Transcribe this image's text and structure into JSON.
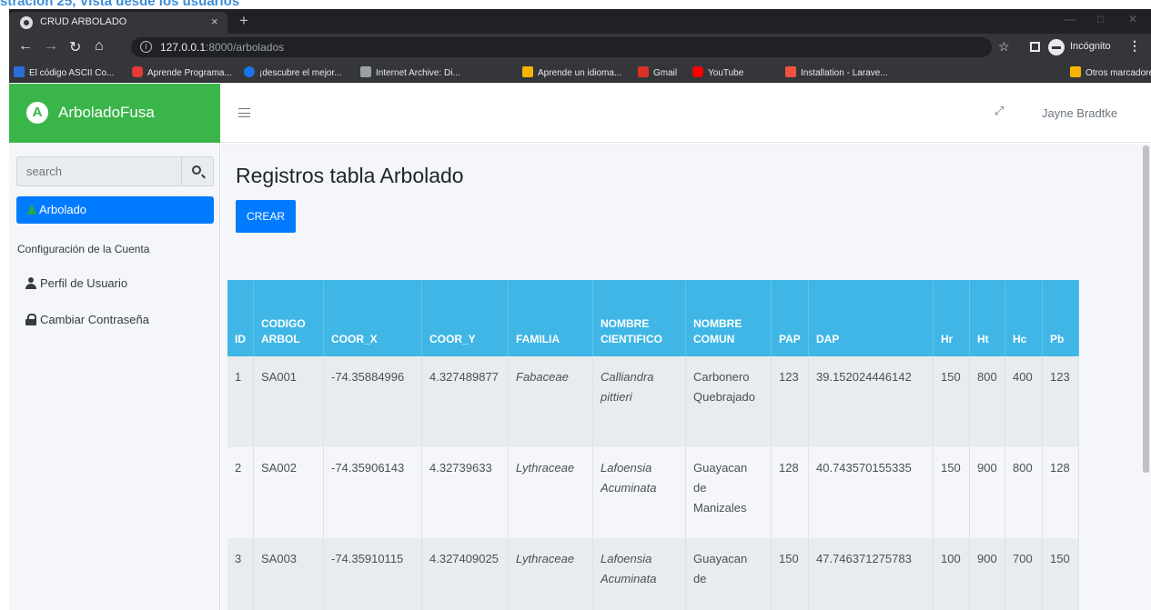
{
  "caption": "stración 25, Vista desde los usuarios",
  "browser": {
    "tab_title": "CRUD ARBOLADO",
    "tab_close": "×",
    "new_tab": "+",
    "url_host": "127.0.0.1",
    "url_rest": ":8000/arbolados",
    "incognito_label": "Incógnito",
    "bookmarks": [
      {
        "label": "El código ASCII Co...",
        "color": "#2a6fdb"
      },
      {
        "label": "Aprende Programa...",
        "color": "#e53935"
      },
      {
        "label": "¡descubre el mejor...",
        "color": "#1a73e8"
      },
      {
        "label": "Internet Archive: Di...",
        "color": "#9aa0a6"
      },
      {
        "label": "Aprende un idioma...",
        "color": "#f6b400"
      },
      {
        "label": "Gmail",
        "color": "#d93025"
      },
      {
        "label": "YouTube",
        "color": "#ff0000"
      },
      {
        "label": "Installation - Larave...",
        "color": "#f05340"
      },
      {
        "label": "Otros marcadores",
        "color": "#f6b400"
      }
    ]
  },
  "sidebar": {
    "brand": "ArboladoFusa",
    "brand_logo": "A",
    "search_placeholder": "search",
    "active_item": "Arbolado",
    "section_header": "Configuración de la Cuenta",
    "items": [
      {
        "label": "Perfil de Usuario",
        "icon": "user-icon"
      },
      {
        "label": "Cambiar Contraseña",
        "icon": "lock-icon"
      }
    ]
  },
  "header": {
    "user_name": "Jayne Bradtke"
  },
  "main": {
    "title": "Registros tabla Arbolado",
    "create_button": "CREAR",
    "table": {
      "columns": [
        [
          "ID"
        ],
        [
          "CODIGO",
          "ARBOL"
        ],
        [
          "COOR_X"
        ],
        [
          "COOR_Y"
        ],
        [
          "FAMILIA"
        ],
        [
          "NOMBRE",
          "CIENTIFICO"
        ],
        [
          "NOMBRE",
          "COMUN"
        ],
        [
          "PAP"
        ],
        [
          "DAP"
        ],
        [
          "Hr"
        ],
        [
          "Ht"
        ],
        [
          "Hc"
        ],
        [
          "Pb"
        ]
      ],
      "rows": [
        [
          [
            "1"
          ],
          [
            "SA001"
          ],
          [
            "-74.35884996"
          ],
          [
            "4.327489877"
          ],
          [
            "Fabaceae"
          ],
          [
            "Calliandra",
            "pittieri"
          ],
          [
            "Carbonero",
            "Quebrajado"
          ],
          [
            "123"
          ],
          [
            "39.152024446142"
          ],
          [
            "150"
          ],
          [
            "800"
          ],
          [
            "400"
          ],
          [
            "123"
          ]
        ],
        [
          [
            "2"
          ],
          [
            "SA002"
          ],
          [
            "-74.35906143"
          ],
          [
            "4.32739633"
          ],
          [
            "Lythraceae"
          ],
          [
            "Lafoensia",
            "Acuminata"
          ],
          [
            "Guayacan",
            "de",
            "Manizales"
          ],
          [
            "128"
          ],
          [
            "40.743570155335"
          ],
          [
            "150"
          ],
          [
            "900"
          ],
          [
            "800"
          ],
          [
            "128"
          ]
        ],
        [
          [
            "3"
          ],
          [
            "SA003"
          ],
          [
            "-74.35910115"
          ],
          [
            "4.327409025"
          ],
          [
            "Lythraceae"
          ],
          [
            "Lafoensia",
            "Acuminata"
          ],
          [
            "Guayacan",
            "de"
          ],
          [
            "150"
          ],
          [
            "47.746371275783"
          ],
          [
            "100"
          ],
          [
            "900"
          ],
          [
            "700"
          ],
          [
            "150"
          ]
        ]
      ]
    }
  }
}
